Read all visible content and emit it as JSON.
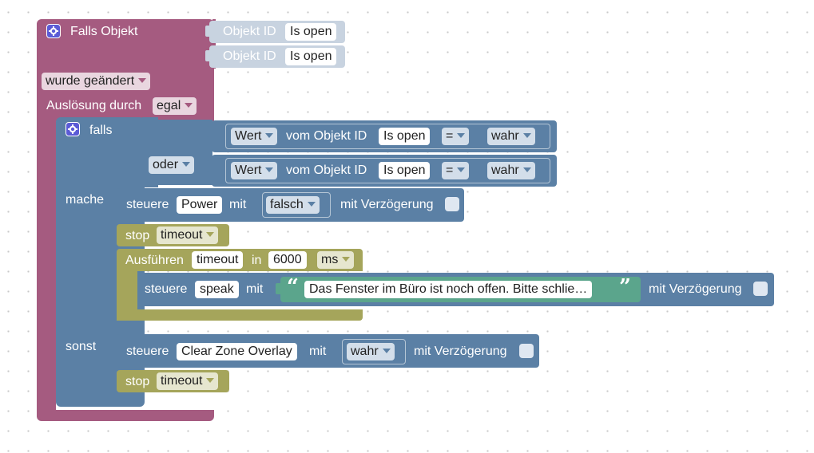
{
  "trigger": {
    "title": "Falls Objekt",
    "object_label": "Objekt ID",
    "object_1": "Is open",
    "object_2": "Is open",
    "mode": "wurde geändert",
    "trigger_by_label": "Auslösung durch",
    "trigger_by_value": "egal"
  },
  "if_block": {
    "if_label": "falls",
    "or_label": "oder",
    "do_label": "mache",
    "else_label": "sonst",
    "cond_1": {
      "prop": "Wert",
      "from": "vom Objekt ID",
      "object": "Is open",
      "op": "=",
      "value": "wahr"
    },
    "cond_2": {
      "prop": "Wert",
      "from": "vom Objekt ID",
      "object": "Is open",
      "op": "=",
      "value": "wahr"
    }
  },
  "control_power": {
    "label": "steuere",
    "target": "Power",
    "with": "mit",
    "value": "falsch",
    "delay": "mit Verzögerung"
  },
  "stop_1": {
    "label": "stop",
    "name": "timeout"
  },
  "exec": {
    "label": "Ausführen",
    "name": "timeout",
    "in": "in",
    "amount": "6000",
    "unit": "ms"
  },
  "control_speak": {
    "label": "steuere",
    "target": "speak",
    "with": "mit",
    "open_quote": "“",
    "text": "Das Fenster im Büro ist noch offen. Bitte schlie…",
    "close_quote": "”",
    "delay": "mit Verzögerung"
  },
  "control_clear": {
    "label": "steuere",
    "target": "Clear Zone Overlay",
    "with": "mit",
    "value": "wahr",
    "delay": "mit Verzögerung"
  },
  "stop_2": {
    "label": "stop",
    "name": "timeout"
  },
  "colors": {
    "trigger": "#a55b80",
    "logic": "#5b80a5",
    "timer": "#a5a55b",
    "text": "#5ba58c",
    "shadow": "#c8d3e0"
  }
}
